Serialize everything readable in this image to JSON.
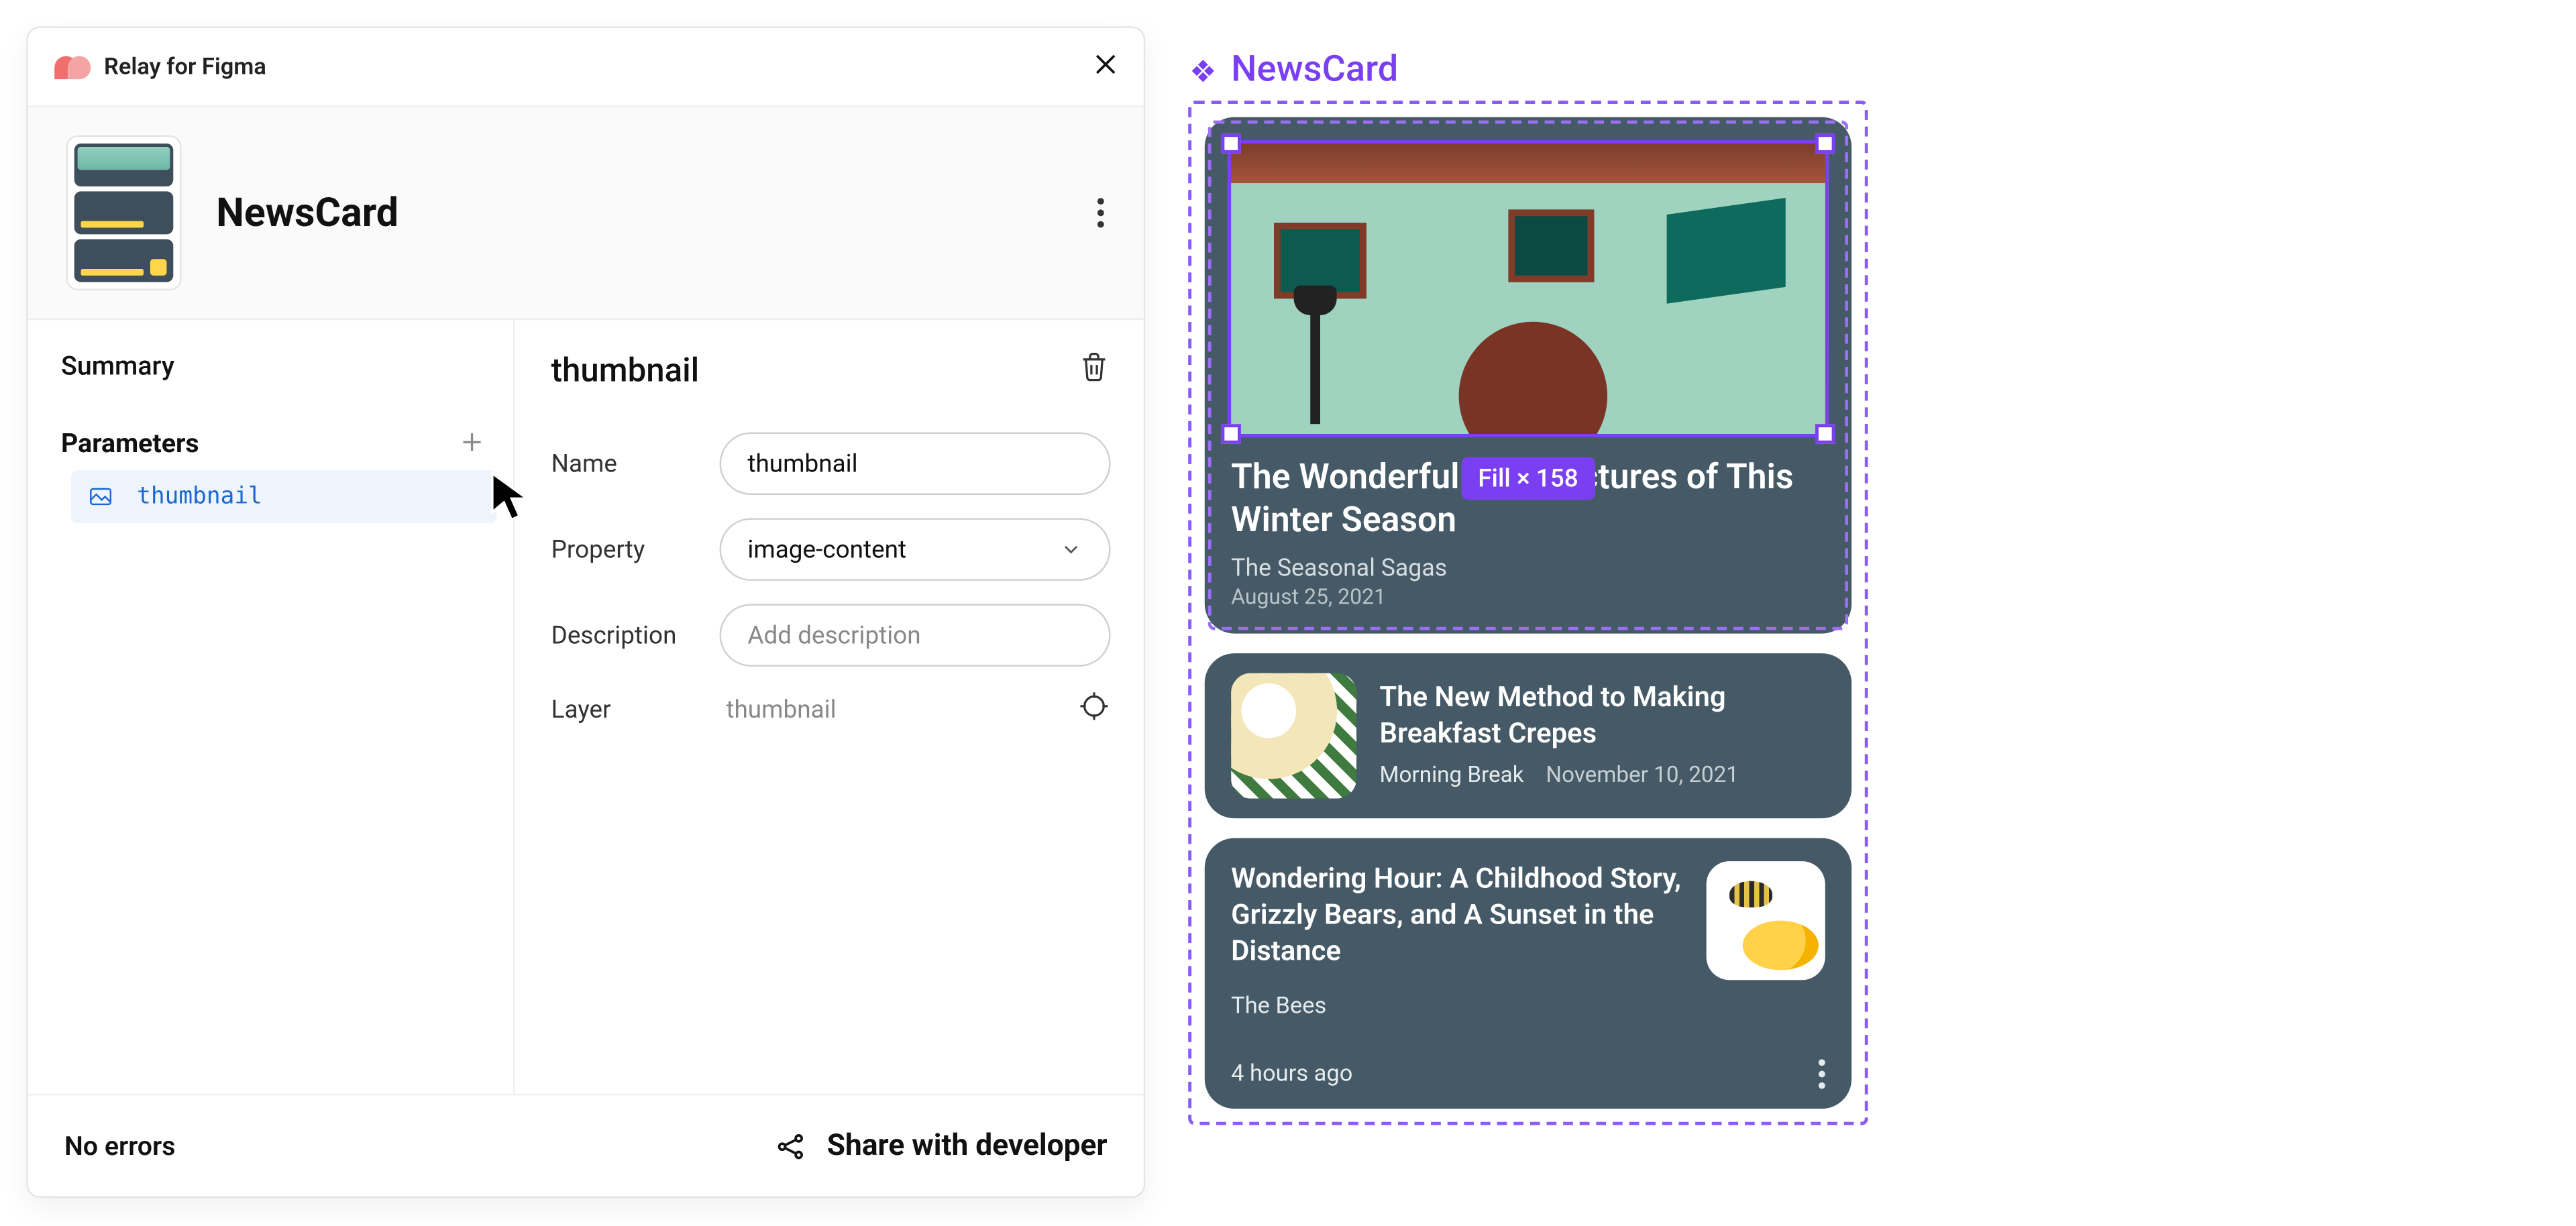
{
  "panel": {
    "app_title": "Relay for Figma",
    "component_name": "NewsCard",
    "summary_label": "Summary",
    "parameters_label": "Parameters",
    "param_items": [
      "thumbnail"
    ],
    "detail_title": "thumbnail",
    "labels": {
      "name": "Name",
      "property": "Property",
      "description": "Description",
      "layer": "Layer"
    },
    "fields": {
      "name_value": "thumbnail",
      "property_value": "image-content",
      "description_placeholder": "Add description",
      "layer_value": "thumbnail"
    },
    "footer": {
      "status": "No errors",
      "share": "Share with developer"
    }
  },
  "canvas": {
    "component_label": "NewsCard",
    "size_pill": "Fill × 158",
    "cards": [
      {
        "title": "The Wonderful Architectures of This Winter Season",
        "author": "The Seasonal Sagas",
        "date": "August 25, 2021"
      },
      {
        "title": "The New Method to Making Breakfast Crepes",
        "author": "Morning Break",
        "date": "November 10, 2021"
      },
      {
        "title": "Wondering Hour: A Childhood Story, Grizzly Bears, and A Sunset in the Distance",
        "author": "The Bees",
        "ago": "4 hours ago"
      }
    ]
  }
}
